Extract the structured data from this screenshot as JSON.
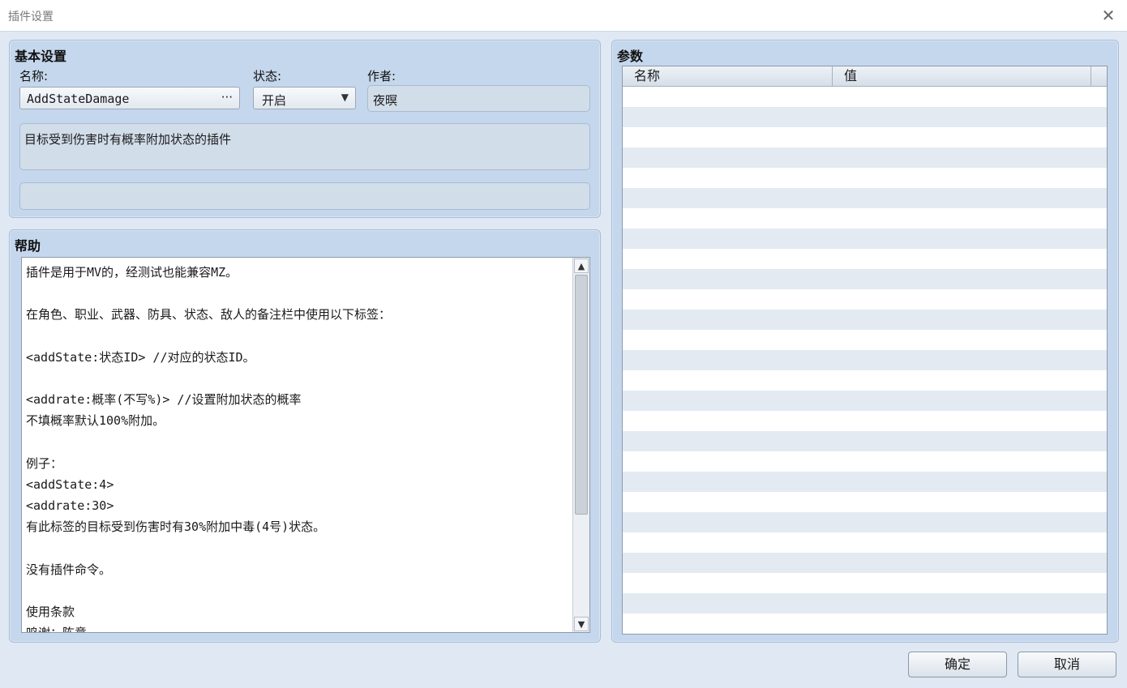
{
  "window": {
    "title": "插件设置",
    "close_glyph": "✕"
  },
  "basic": {
    "title": "基本设置",
    "name_label": "名称:",
    "name_value": "AddStateDamage",
    "name_ellipsis": "···",
    "status_label": "状态:",
    "status_value": "开启",
    "status_arrow": "▼",
    "author_label": "作者:",
    "author_value": "夜暝",
    "description": "目标受到伤害时有概率附加状态的插件"
  },
  "help": {
    "title": "帮助",
    "lines": [
      "插件是用于MV的，经测试也能兼容MZ。",
      "",
      "在角色、职业、武器、防具、状态、敌人的备注栏中使用以下标签：",
      "",
      "<addState:状态ID> //对应的状态ID。",
      "",
      "<addrate:概率(不写%)> //设置附加状态的概率",
      "不填概率默认100%附加。",
      "",
      "例子：",
      "<addState:4>",
      "<addrate:30>",
      "有此标签的目标受到伤害时有30%附加中毒(4号)状态。",
      "",
      "没有插件命令。",
      "",
      "使用条款",
      "鸣谢：陈意"
    ],
    "scroll_up": "▲",
    "scroll_down": "▼"
  },
  "params": {
    "title": "参数",
    "col_name": "名称",
    "col_value": "值"
  },
  "buttons": {
    "ok": "确定",
    "cancel": "取消"
  }
}
